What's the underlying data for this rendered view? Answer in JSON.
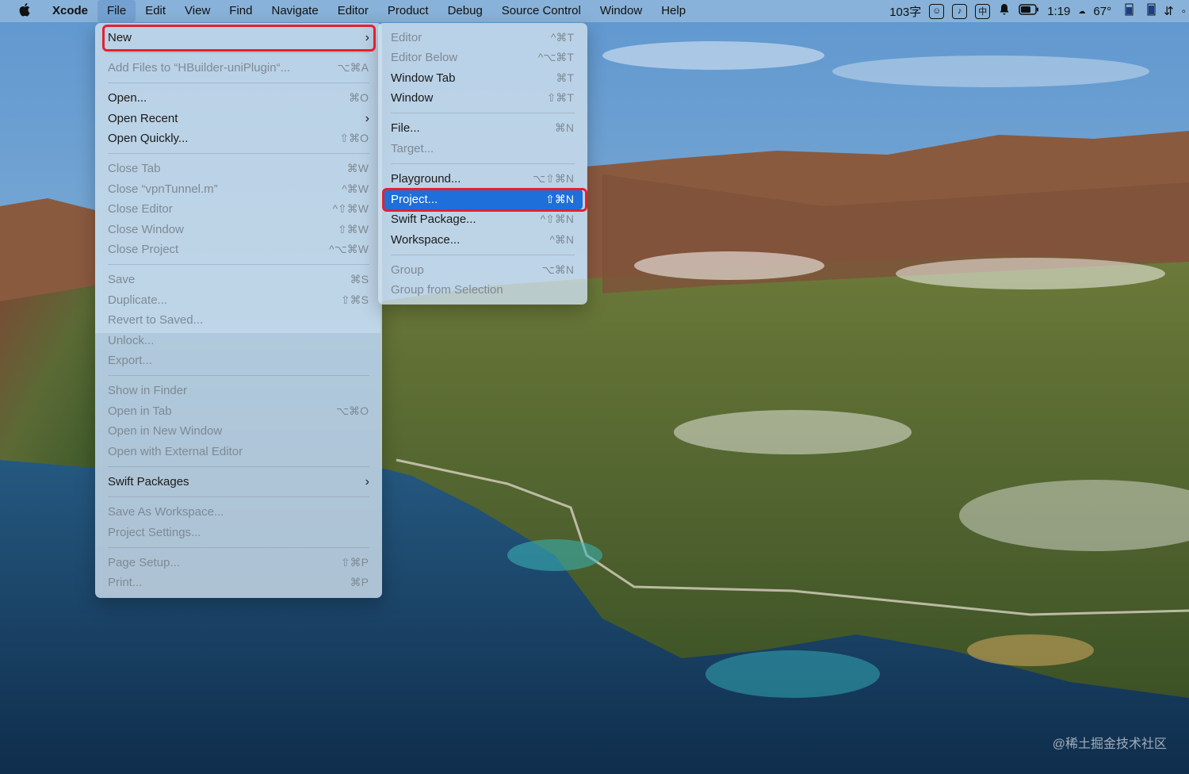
{
  "menubar": {
    "apple": "",
    "items": [
      "Xcode",
      "File",
      "Edit",
      "View",
      "Find",
      "Navigate",
      "Editor",
      "Product",
      "Debug",
      "Source Control",
      "Window",
      "Help"
    ],
    "status": {
      "word_count": "103字",
      "time": "1:19",
      "temp": "67°"
    }
  },
  "file_menu": {
    "items": [
      {
        "label": "New",
        "shortcut": "",
        "submenu": true,
        "disabled": false
      },
      {
        "label": "Add Files to “HBuilder-uniPlugin“...",
        "shortcut": "⌥⌘A",
        "disabled": true
      },
      {
        "label": "Open...",
        "shortcut": "⌘O",
        "disabled": false
      },
      {
        "label": "Open Recent",
        "shortcut": "",
        "submenu": true,
        "disabled": false
      },
      {
        "label": "Open Quickly...",
        "shortcut": "⇧⌘O",
        "disabled": false
      },
      {
        "label": "Close Tab",
        "shortcut": "⌘W",
        "disabled": true
      },
      {
        "label": "Close “vpnTunnel.m”",
        "shortcut": "^⌘W",
        "disabled": true
      },
      {
        "label": "Close Editor",
        "shortcut": "^⇧⌘W",
        "disabled": true
      },
      {
        "label": "Close Window",
        "shortcut": "⇧⌘W",
        "disabled": true
      },
      {
        "label": "Close Project",
        "shortcut": "^⌥⌘W",
        "disabled": true
      },
      {
        "label": "Save",
        "shortcut": "⌘S",
        "disabled": true
      },
      {
        "label": "Duplicate...",
        "shortcut": "⇧⌘S",
        "disabled": true
      },
      {
        "label": "Revert to Saved...",
        "shortcut": "",
        "disabled": true
      },
      {
        "label": "Unlock...",
        "shortcut": "",
        "disabled": true
      },
      {
        "label": "Export...",
        "shortcut": "",
        "disabled": true
      },
      {
        "label": "Show in Finder",
        "shortcut": "",
        "disabled": true
      },
      {
        "label": "Open in Tab",
        "shortcut": "⌥⌘O",
        "disabled": true
      },
      {
        "label": "Open in New Window",
        "shortcut": "",
        "disabled": true
      },
      {
        "label": "Open with External Editor",
        "shortcut": "",
        "disabled": true
      },
      {
        "label": "Swift Packages",
        "shortcut": "",
        "submenu": true,
        "disabled": false
      },
      {
        "label": "Save As Workspace...",
        "shortcut": "",
        "disabled": true
      },
      {
        "label": "Project Settings...",
        "shortcut": "",
        "disabled": true
      },
      {
        "label": "Page Setup...",
        "shortcut": "⇧⌘P",
        "disabled": true
      },
      {
        "label": "Print...",
        "shortcut": "⌘P",
        "disabled": true
      }
    ]
  },
  "new_submenu": {
    "items": [
      {
        "label": "Editor",
        "shortcut": "^⌘T",
        "disabled": true
      },
      {
        "label": "Editor Below",
        "shortcut": "^⌥⌘T",
        "disabled": true
      },
      {
        "label": "Window Tab",
        "shortcut": "⌘T",
        "disabled": false
      },
      {
        "label": "Window",
        "shortcut": "⇧⌘T",
        "disabled": false
      },
      {
        "label": "File...",
        "shortcut": "⌘N",
        "disabled": false
      },
      {
        "label": "Target...",
        "shortcut": "",
        "disabled": true
      },
      {
        "label": "Playground...",
        "shortcut": "⌥⇧⌘N",
        "disabled": false
      },
      {
        "label": "Project...",
        "shortcut": "⇧⌘N",
        "disabled": false,
        "selected": true
      },
      {
        "label": "Swift Package...",
        "shortcut": "^⇧⌘N",
        "disabled": false
      },
      {
        "label": "Workspace...",
        "shortcut": "^⌘N",
        "disabled": false
      },
      {
        "label": "Group",
        "shortcut": "⌥⌘N",
        "disabled": true
      },
      {
        "label": "Group from Selection",
        "shortcut": "",
        "disabled": true
      }
    ]
  },
  "watermark": "@稀土掘金技术社区",
  "colors": {
    "selection": "#1e6fd9",
    "highlight_box": "#e5202f",
    "menu_bg": "rgba(205,222,235,0.82)"
  }
}
